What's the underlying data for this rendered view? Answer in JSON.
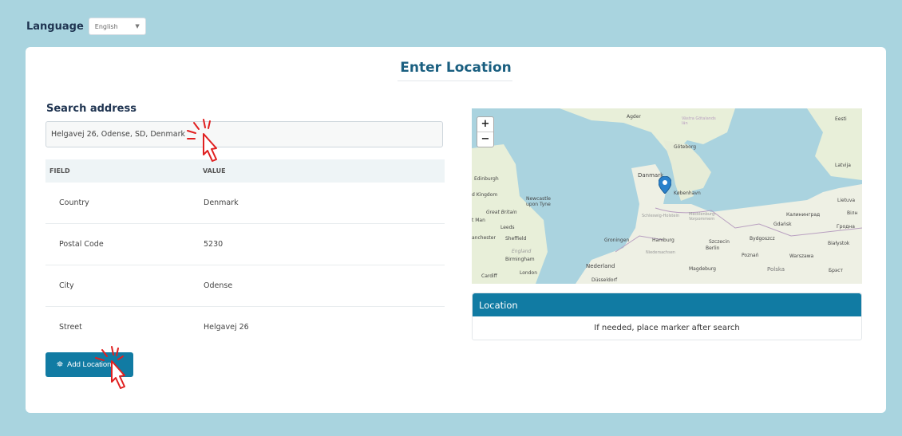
{
  "language": {
    "label": "Language",
    "selected": "English"
  },
  "page": {
    "title": "Enter Location"
  },
  "search": {
    "heading": "Search address",
    "value": "Helgavej 26, Odense, SD, Denmark"
  },
  "table": {
    "headers": [
      "FIELD",
      "VALUE"
    ],
    "rows": [
      {
        "field": "Country",
        "value": "Denmark"
      },
      {
        "field": "Postal Code",
        "value": "5230"
      },
      {
        "field": "City",
        "value": "Odense"
      },
      {
        "field": "Street",
        "value": "Helgavej 26"
      }
    ]
  },
  "add_button": {
    "label": "Add Location"
  },
  "map": {
    "zoom_in": "+",
    "zoom_out": "−",
    "labels": [
      "Eesti",
      "Latvija",
      "Lietuva",
      "Göteborg",
      "Danmark",
      "København",
      "Edinburgh",
      "d Kingdom",
      "Newcastle upon Tyne",
      "Great Britain",
      "t Man",
      "Leeds",
      "anchester",
      "Sheffield",
      "England",
      "Birmingham",
      "Cardiff",
      "London",
      "Nederland",
      "Düsseldorf",
      "Groningen",
      "Hamburg",
      "Schleswig-Holstein",
      "Mecklenburg-Vorpommern",
      "Niedersachsen",
      "Berlin",
      "Magdeburg",
      "Szczecin",
      "Bydgoszcz",
      "Gdańsk",
      "Poznań",
      "Polska",
      "Warszawa",
      "Białystok",
      "Калининград",
      "Гродна",
      "Вілн",
      "Брэст",
      "Agder",
      "Västra Götalands län"
    ]
  },
  "location_panel": {
    "header": "Location",
    "message": "If needed, place marker after search"
  },
  "colors": {
    "accent": "#117ba3",
    "background": "#a9d4df",
    "title": "#1a5f80"
  }
}
